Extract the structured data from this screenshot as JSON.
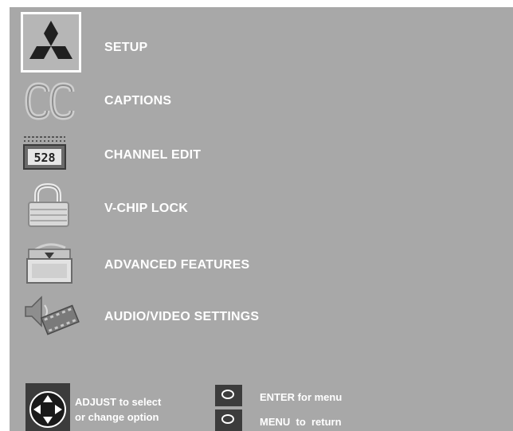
{
  "menu": {
    "items": [
      {
        "label": "SETUP",
        "icon": "mitsubishi-logo-icon",
        "selected": true
      },
      {
        "label": "CAPTIONS",
        "icon": "closed-caption-icon",
        "selected": false
      },
      {
        "label": "CHANNEL EDIT",
        "icon": "channel-counter-icon",
        "selected": false
      },
      {
        "label": "V-CHIP LOCK",
        "icon": "padlock-icon",
        "selected": false
      },
      {
        "label": "ADVANCED FEATURES",
        "icon": "advanced-features-tv-icon",
        "selected": false
      },
      {
        "label": "AUDIO/VIDEO SETTINGS",
        "icon": "speaker-film-icon",
        "selected": false
      }
    ],
    "channel_digits": "528"
  },
  "footer": {
    "adjust_line1": "ADJUST to select",
    "adjust_line2": "or change option",
    "enter_label": "ENTER for menu",
    "menu_label": "MENU  to  return"
  },
  "colors": {
    "background": "#a8a8a8",
    "text": "#ffffff",
    "selection_border": "#ffffff"
  }
}
